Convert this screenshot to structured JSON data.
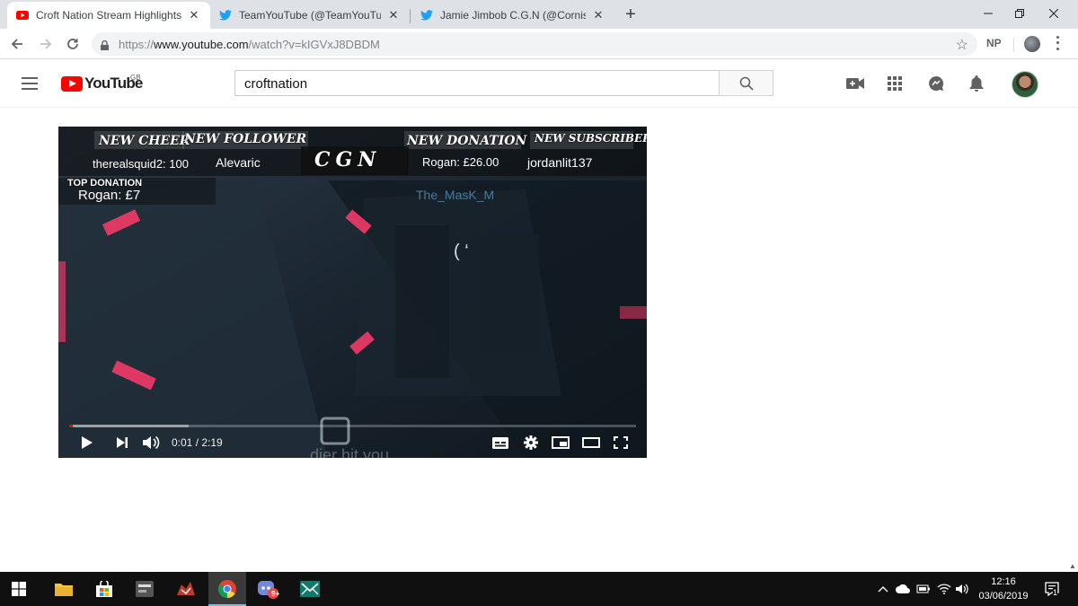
{
  "browser": {
    "tabs": [
      {
        "label": "Croft Nation Stream Highlights: N",
        "icon": "youtube-icon"
      },
      {
        "label": "TeamYouTube (@TeamYouTube) |",
        "icon": "twitter-icon"
      },
      {
        "label": "Jamie Jimbob C.G.N (@CornishG",
        "icon": "twitter-icon"
      }
    ],
    "new_tab": "+",
    "url": {
      "scheme": "https://",
      "host": "www.youtube.com",
      "path": "/watch?v=kIGVxJ8DBDM"
    },
    "extension_label": "NP"
  },
  "youtube": {
    "logo_word": "YouTube",
    "country_code": "GB",
    "search_value": "croftnation"
  },
  "video": {
    "overlay": {
      "new_cheer_label": "NEW CHEER",
      "new_cheer_value": "therealsquid2: 100",
      "new_follower_label": "NEW FOLLOWER",
      "new_follower_value": "Alevaric",
      "logo_text": "CGN",
      "new_donation_label": "NEW DONATION",
      "new_donation_value": "Rogan: £26.00",
      "new_subscriber_label": "NEW SUBSCRIBER",
      "new_subscriber_value": "jordanlit137",
      "top_donation_label": "TOP DONATION",
      "top_donation_value": "Rogan: £7",
      "background_text": "The_MasK_M"
    },
    "current_time": "0:01",
    "duration": "2:19",
    "time_display": "0:01 / 2:19",
    "progress_fraction": 0.007,
    "buffered_fraction": 0.21
  },
  "taskbar": {
    "clock_time": "12:16",
    "clock_date": "03/06/2019",
    "notification_count": "1",
    "discord_badge": "9+"
  },
  "colors": {
    "youtube_red": "#ff0000",
    "taskbar_bg": "#101010",
    "tabstrip_bg": "#dee1e6",
    "twitter_blue": "#1da1f2"
  }
}
